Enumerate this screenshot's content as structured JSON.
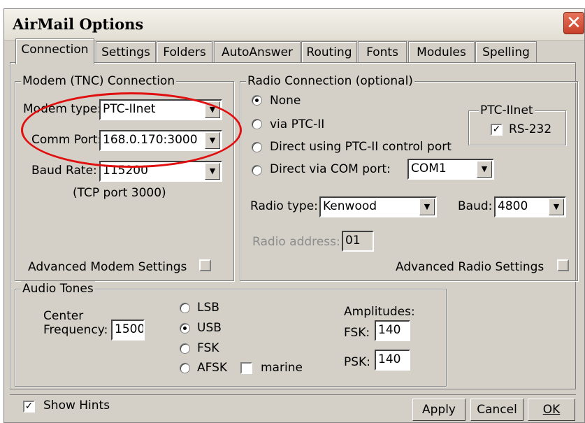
{
  "window": {
    "title": "AirMail Options",
    "close_icon": "close-icon"
  },
  "tabs": [
    {
      "label": "Connection",
      "active": true
    },
    {
      "label": "Settings"
    },
    {
      "label": "Folders"
    },
    {
      "label": "AutoAnswer"
    },
    {
      "label": "Routing"
    },
    {
      "label": "Fonts"
    },
    {
      "label": "Modules"
    },
    {
      "label": "Spelling"
    }
  ],
  "modem": {
    "legend": "Modem (TNC) Connection",
    "type_label": "Modem type:",
    "type_value": "PTC-IInet",
    "port_label": "Comm Port:",
    "port_value": "168.0.170:3000",
    "baud_label": "Baud Rate:",
    "baud_value": "115200",
    "tcp_note": "(TCP port 3000)",
    "advanced_label": "Advanced Modem Settings"
  },
  "radio": {
    "legend": "Radio Connection (optional)",
    "opt_none": "None",
    "opt_ptc": "via PTC-II",
    "opt_direct_ptc": "Direct using PTC-II control port",
    "opt_direct_com": "Direct via COM port:",
    "com_value": "COM1",
    "ptc_group": "PTC-IInet",
    "rs232_label": "RS-232",
    "type_label": "Radio type:",
    "type_value": "Kenwood",
    "baud_label": "Baud:",
    "baud_value": "4800",
    "address_label": "Radio address:",
    "address_value": "01",
    "advanced_label": "Advanced Radio Settings"
  },
  "audio": {
    "legend": "Audio Tones",
    "center_label_1": "Center",
    "center_label_2": "Frequency:",
    "center_value": "1500",
    "opt_lsb": "LSB",
    "opt_usb": "USB",
    "opt_fsk": "FSK",
    "opt_afsk": "AFSK",
    "marine_label": "marine",
    "amplitudes_label": "Amplitudes:",
    "fsk_label": "FSK:",
    "fsk_value": "140",
    "psk_label": "PSK:",
    "psk_value": "140"
  },
  "footer": {
    "show_hints": "Show Hints",
    "apply": "Apply",
    "cancel": "Cancel",
    "ok": "OK"
  },
  "colors": {
    "highlight_ellipse": "#e01010"
  }
}
